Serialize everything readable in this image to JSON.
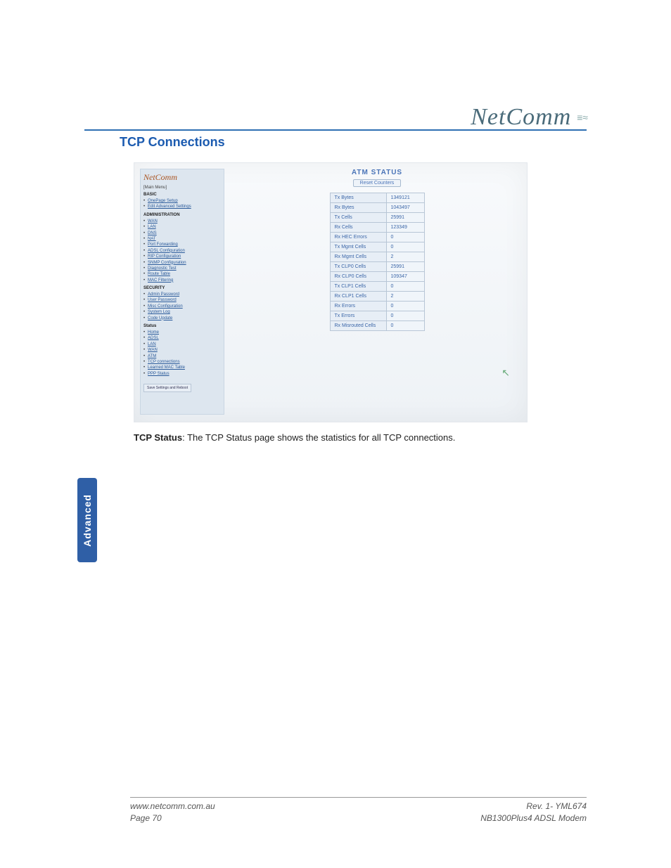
{
  "brand": {
    "name": "NetComm"
  },
  "section_title": "TCP Connections",
  "side_tab": "Advanced",
  "body": {
    "label": "TCP Status",
    "text": ":  The TCP Status page shows the statistics for all TCP connections."
  },
  "footer": {
    "left1": "www.netcomm.com.au",
    "left2": "Page 70",
    "right1": "Rev. 1- YML674",
    "right2": "NB1300Plus4 ADSL Modem"
  },
  "screenshot": {
    "sidebar": {
      "logo": "NetComm",
      "heading": "[Main Menu]",
      "groups": [
        {
          "title": "BASIC",
          "items": [
            "OnePage Setup",
            "Edit Advanced Settings"
          ]
        },
        {
          "title": "ADMINISTRATION",
          "items": [
            "WAN",
            "LAN",
            "DNS",
            "NAT",
            "Port Forwarding",
            "ADSL Configuration",
            "RIP Configuration",
            "SNMP Configuration",
            "Diagnostic Test",
            "Route Table",
            "MAC Filtering"
          ]
        },
        {
          "title": "SECURITY",
          "items": [
            "Admin Password",
            "User Password",
            "Misc Configuration",
            "System Log",
            "Code Update"
          ]
        },
        {
          "title": "Status",
          "items": [
            "Home",
            "ADSL",
            "LAN",
            "WAN",
            "ATM",
            "TCP connections",
            "Learned MAC Table",
            "PPP Status"
          ]
        }
      ],
      "button": "Save Settings and Reboot"
    },
    "content": {
      "title": "ATM STATUS",
      "reset_btn": "Reset Counters",
      "rows": [
        {
          "k": "Tx Bytes",
          "v": "1349121"
        },
        {
          "k": "Rx Bytes",
          "v": "1043497"
        },
        {
          "k": "Tx Cells",
          "v": "25991"
        },
        {
          "k": "Rx Cells",
          "v": "123349"
        },
        {
          "k": "Rx HEC Errors",
          "v": "0"
        },
        {
          "k": "Tx Mgmt Cells",
          "v": "0"
        },
        {
          "k": "Rx Mgmt Cells",
          "v": "2"
        },
        {
          "k": "Tx CLP0 Cells",
          "v": "25991"
        },
        {
          "k": "Rx CLP0 Cells",
          "v": "109347"
        },
        {
          "k": "Tx CLP1 Cells",
          "v": "0"
        },
        {
          "k": "Rx CLP1 Cells",
          "v": "2"
        },
        {
          "k": "Rx Errors",
          "v": "0"
        },
        {
          "k": "Tx Errors",
          "v": "0"
        },
        {
          "k": "Rx Misrouted Cells",
          "v": "0"
        }
      ]
    }
  }
}
